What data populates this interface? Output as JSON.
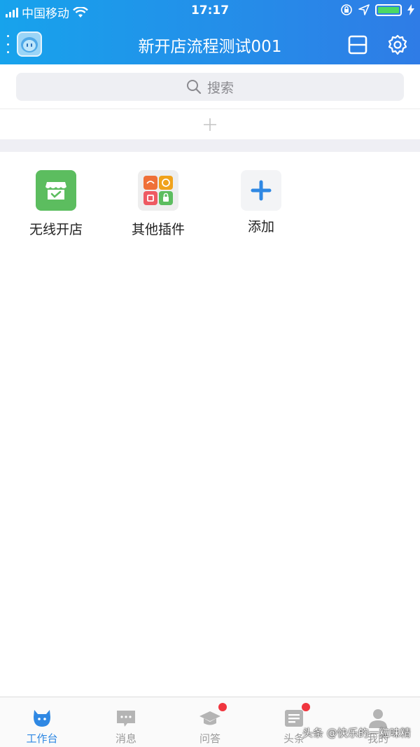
{
  "status_bar": {
    "carrier": "中国移动",
    "time": "17:17"
  },
  "navbar": {
    "title": "新开店流程测试001",
    "menu_icon": "more-dots-icon",
    "scan_icon": "scan-icon",
    "settings_icon": "gear-icon"
  },
  "search": {
    "placeholder": "搜索"
  },
  "apps": [
    {
      "label": "无线开店",
      "icon": "store-icon",
      "color": "#5cbd5f"
    },
    {
      "label": "其他插件",
      "icon": "plugins-grid-icon",
      "color": "#eeeeee"
    },
    {
      "label": "添加",
      "icon": "plus-icon",
      "color": "#2f88e3"
    }
  ],
  "tabs": [
    {
      "label": "工作台",
      "icon": "workbench-icon",
      "active": true
    },
    {
      "label": "消息",
      "icon": "chat-icon"
    },
    {
      "label": "问答",
      "icon": "graduation-cap-icon",
      "badge": true
    },
    {
      "label": "头条",
      "icon": "news-icon",
      "badge": true
    },
    {
      "label": "我的",
      "icon": "person-icon"
    }
  ],
  "colors": {
    "accent": "#2f88e3",
    "header_start": "#17a3ec",
    "header_end": "#2f7ce6",
    "badge": "#f0363f"
  },
  "watermark": "头条 @快乐的一粒味精"
}
